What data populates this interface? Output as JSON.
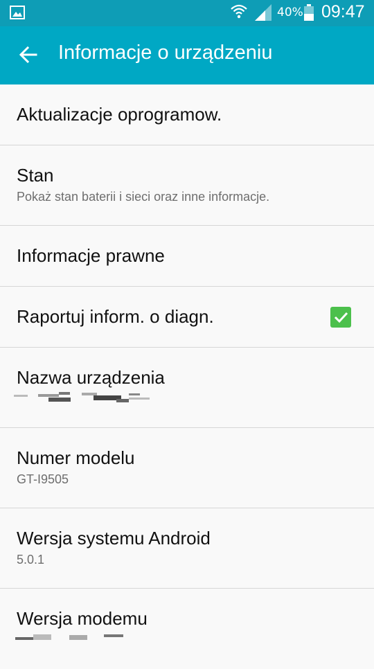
{
  "status_bar": {
    "battery_percent": "40%",
    "time": "09:47",
    "icons": [
      "gallery-icon",
      "wifi-icon",
      "signal-icon",
      "battery-icon"
    ]
  },
  "app_bar": {
    "title": "Informacje o urządzeniu",
    "back_icon": "arrow-left-icon"
  },
  "items": [
    {
      "title": "Aktualizacje oprogramow."
    },
    {
      "title": "Stan",
      "subtitle": "Pokaż stan baterii i sieci oraz inne informacje."
    },
    {
      "title": "Informacje prawne"
    },
    {
      "title": "Raportuj inform. o diagn.",
      "checked": true
    },
    {
      "title": "Nazwa urządzenia"
    },
    {
      "title": "Numer modelu",
      "subtitle": "GT-I9505"
    },
    {
      "title": "Wersja systemu Android",
      "subtitle": "5.0.1"
    },
    {
      "title": "Wersja modemu"
    }
  ],
  "colors": {
    "status_bar": "#0e9db6",
    "app_bar": "#00a8c4",
    "checkbox": "#4cc04c",
    "background": "#f9f9f9"
  }
}
